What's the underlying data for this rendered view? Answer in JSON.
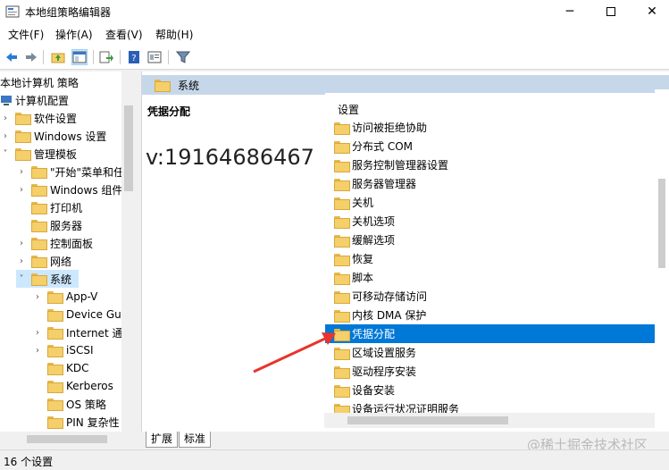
{
  "window": {
    "title": "本地组策略编辑器"
  },
  "menu": [
    "文件(F)",
    "操作(A)",
    "查看(V)",
    "帮助(H)"
  ],
  "toolbar": [
    "back-icon",
    "forward-icon",
    "up-folder-icon",
    "show-hide-tree-icon",
    "export-list-icon",
    "help-icon",
    "properties-icon",
    "filter-icon"
  ],
  "tree": [
    {
      "label": "本地计算机 策略",
      "level": 0
    },
    {
      "label": "计算机配置",
      "level": 0
    },
    {
      "label": "软件设置",
      "level": 1
    },
    {
      "label": "Windows 设置",
      "level": 1
    },
    {
      "label": "管理模板",
      "level": 1
    },
    {
      "label": "\"开始\"菜单和任",
      "level": 2
    },
    {
      "label": "Windows 组件",
      "level": 2
    },
    {
      "label": "打印机",
      "level": 2
    },
    {
      "label": "服务器",
      "level": 2
    },
    {
      "label": "控制面板",
      "level": 2
    },
    {
      "label": "网络",
      "level": 2
    },
    {
      "label": "系统",
      "level": 2
    },
    {
      "label": "App-V",
      "level": 3
    },
    {
      "label": "Device Gua",
      "level": 3
    },
    {
      "label": "Internet 通",
      "level": 3
    },
    {
      "label": "iSCSI",
      "level": 3
    },
    {
      "label": "KDC",
      "level": 3
    },
    {
      "label": "Kerberos",
      "level": 3
    },
    {
      "label": "OS 策略",
      "level": 3
    },
    {
      "label": "PIN 复杂性",
      "level": 3
    }
  ],
  "right": {
    "header": "系统",
    "desc_title": "凭据分配",
    "overlay_id": "v:19164686467",
    "list_header": "设置",
    "items": [
      "访问被拒绝协助",
      "分布式 COM",
      "服务控制管理器设置",
      "服务器管理器",
      "关机",
      "关机选项",
      "缓解选项",
      "恢复",
      "脚本",
      "可移动存储访问",
      "内核 DMA 保护",
      "凭据分配",
      "区域设置服务",
      "驱动程序安装",
      "设备安装",
      "设备运行状况证明服务"
    ],
    "selected_index": 11
  },
  "tabs": [
    "扩展",
    "标准"
  ],
  "watermark": "@稀土掘金技术社区",
  "status": "16 个设置",
  "colors": {
    "selection": "#0078d7",
    "header_band": "#c7d7ea",
    "arrow": "#e8342c"
  }
}
